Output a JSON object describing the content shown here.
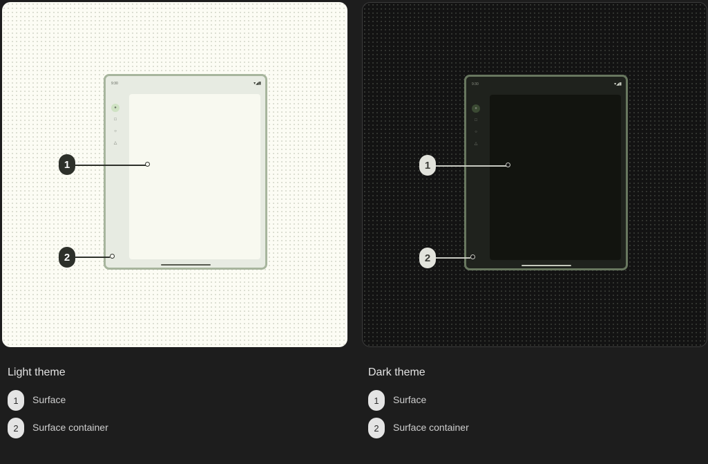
{
  "light": {
    "title": "Light theme",
    "device": {
      "time": "9:30",
      "status_icons": "▾◢▮",
      "rail_icons": [
        "●",
        "□",
        "○",
        "△"
      ]
    },
    "callouts": [
      "1",
      "2"
    ],
    "legend": [
      {
        "number": "1",
        "label": "Surface"
      },
      {
        "number": "2",
        "label": "Surface container"
      }
    ]
  },
  "dark": {
    "title": "Dark theme",
    "device": {
      "time": "9:30",
      "status_icons": "▾◢▮",
      "rail_icons": [
        "●",
        "□",
        "○",
        "△"
      ]
    },
    "callouts": [
      "1",
      "2"
    ],
    "legend": [
      {
        "number": "1",
        "label": "Surface"
      },
      {
        "number": "2",
        "label": "Surface container"
      }
    ]
  }
}
